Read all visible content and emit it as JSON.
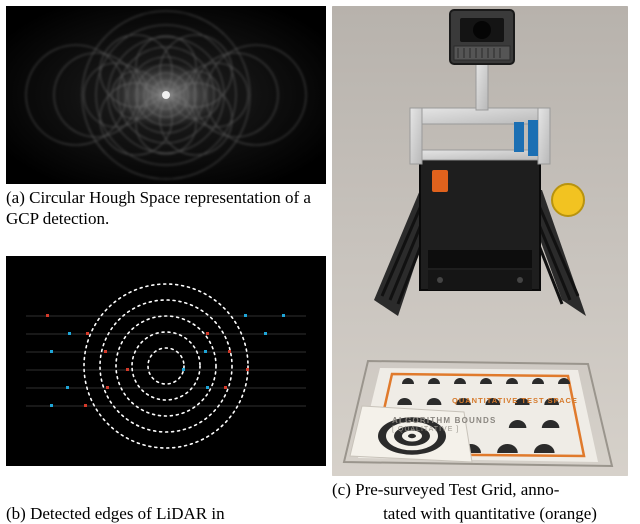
{
  "captions": {
    "a": "(a) Circular Hough Space representation of a GCP detection.",
    "b": "(b) Detected edges of LiDAR in",
    "c": "(c) Pre-surveyed Test Grid, anno-",
    "c_line2": "tated with quantitative (orange)"
  },
  "annotations": {
    "qual_title": "ALGORITHM BOUNDS",
    "qual_sub": "[ QUALITATIVE ]",
    "quant": "QUANTITATIVE TEST SPACE"
  },
  "icons": {
    "hough": "hough-space-render",
    "edges": "lidar-edge-render",
    "robot": "tracked-robot-photo",
    "target": "concentric-target"
  }
}
